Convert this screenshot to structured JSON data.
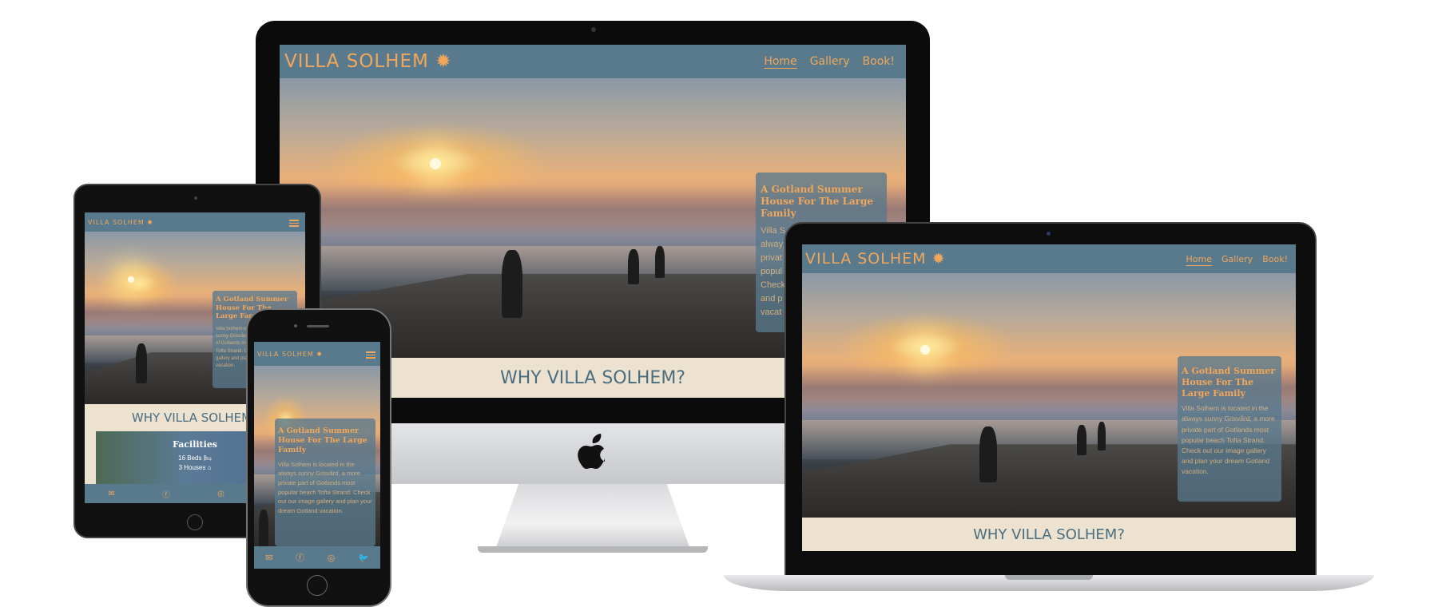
{
  "site": {
    "brand": "VILLA SOLHEM",
    "nav": [
      "Home",
      "Gallery",
      "Book!"
    ],
    "hero_card": {
      "title": "A Gotland Summer House For The Large Family",
      "desktop_body_fragment": [
        "Villa S",
        "alway",
        "privat",
        "popul",
        "Check",
        "and p",
        "vacat"
      ],
      "body": "Villa Solhem is located in the always sunny Grisvård, a more private part of Gotlands most popular beach Tofta Strand. Check out our image gallery and plan your dream Gotland vacation."
    },
    "why": "WHY VILLA SOLHEM?",
    "facilities": {
      "title": "Facilities",
      "items": [
        "16 Beds",
        "3 Houses"
      ]
    },
    "footer_icons": [
      "envelope-icon",
      "facebook-icon",
      "instagram-icon",
      "twitter-icon"
    ]
  },
  "colors": {
    "nav_bg": "#587a8c",
    "accent": "#f1a75b",
    "why_bg": "#ece2cf",
    "why_text": "#4a6d80"
  }
}
